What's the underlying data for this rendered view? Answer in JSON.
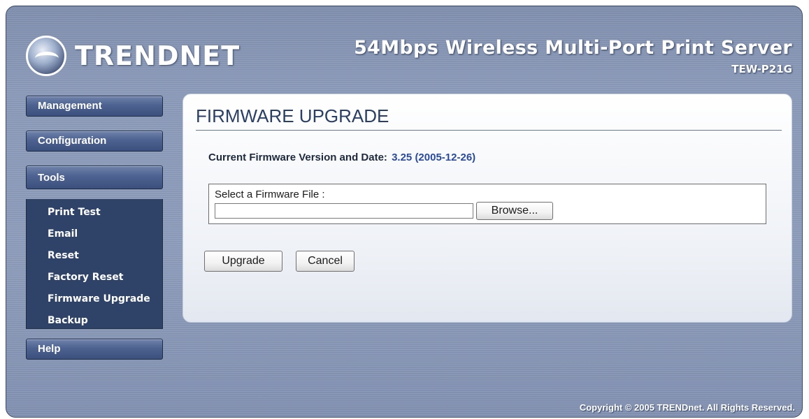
{
  "header": {
    "brand": "TRENDnet",
    "brand_display": "TRENDNET",
    "product_name": "54Mbps Wireless Multi-Port Print Server",
    "model": "TEW-P21G"
  },
  "sidebar": {
    "management": "Management",
    "configuration": "Configuration",
    "tools": "Tools",
    "tools_items": [
      "Print Test",
      "Email",
      "Reset",
      "Factory Reset",
      "Firmware Upgrade",
      "Backup"
    ],
    "help": "Help"
  },
  "main": {
    "title": "FIRMWARE UPGRADE",
    "firmware_label": "Current Firmware Version and Date:",
    "firmware_value": "3.25 (2005-12-26)",
    "file_label": "Select a Firmware File :",
    "file_value": "",
    "browse": "Browse...",
    "upgrade": "Upgrade",
    "cancel": "Cancel"
  },
  "footer": {
    "copyright": "Copyright © 2005 TRENDnet. All Rights Reserved."
  },
  "colors": {
    "background": "#8a99b7",
    "sidebar": "#2f4369",
    "title": "#2a3f66",
    "firmware_value": "#2a4aa0"
  }
}
